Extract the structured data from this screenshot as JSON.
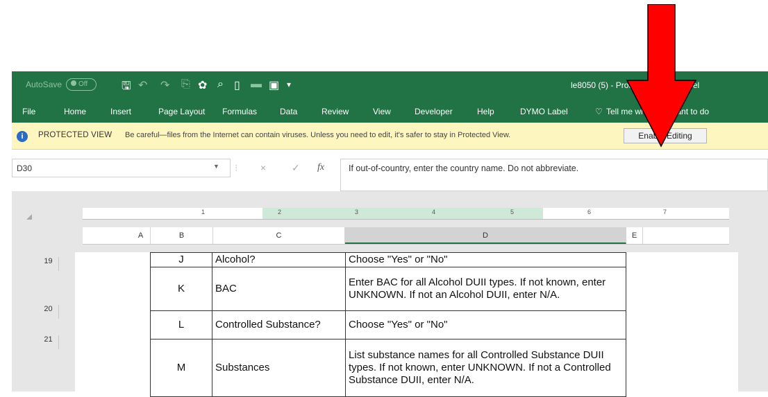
{
  "titlebar": {
    "autosave_label": "AutoSave",
    "autosave_state": "Off",
    "doc_title": "le8050 (5)  -  Protected View  -  Excel"
  },
  "ribbon_tabs": [
    "File",
    "Home",
    "Insert",
    "Page Layout",
    "Formulas",
    "Data",
    "Review",
    "View",
    "Developer",
    "Help",
    "DYMO Label"
  ],
  "tell_me": "Tell me what you want to do",
  "protected_view": {
    "label": "PROTECTED VIEW",
    "message": "Be careful—files from the Internet can contain viruses. Unless you need to edit, it's safer to stay in Protected View.",
    "button": "Enable Editing"
  },
  "formula_bar": {
    "name_box": "D30",
    "cancel": "×",
    "enter": "✓",
    "fx": "fx",
    "formula": "If out-of-country, enter the country name. Do not abbreviate."
  },
  "ruler_numbers": [
    "1",
    "2",
    "3",
    "4",
    "5",
    "6",
    "7"
  ],
  "columns": [
    "A",
    "B",
    "C",
    "D",
    "E"
  ],
  "rows": [
    {
      "num": "19",
      "b": "J",
      "c": "Alcohol?",
      "d": "Choose \"Yes\" or \"No\""
    },
    {
      "num": "20",
      "b": "K",
      "c": "BAC",
      "d": "Enter BAC for all Alcohol DUII types. If not known, enter UNKNOWN. If not an Alcohol DUII, enter N/A."
    },
    {
      "num": "21",
      "b": "L",
      "c": "Controlled Substance?",
      "d": "Choose \"Yes\" or \"No\""
    },
    {
      "num": "",
      "b": "M",
      "c": "Substances",
      "d": "List substance names for all Controlled Substance DUII types. If not known, enter UNKNOWN. If not a Controlled Substance DUII, enter N/A."
    }
  ],
  "colors": {
    "excel_green": "#217346",
    "protected_bar": "#fdf6bf",
    "arrow_red": "#ff0000"
  }
}
